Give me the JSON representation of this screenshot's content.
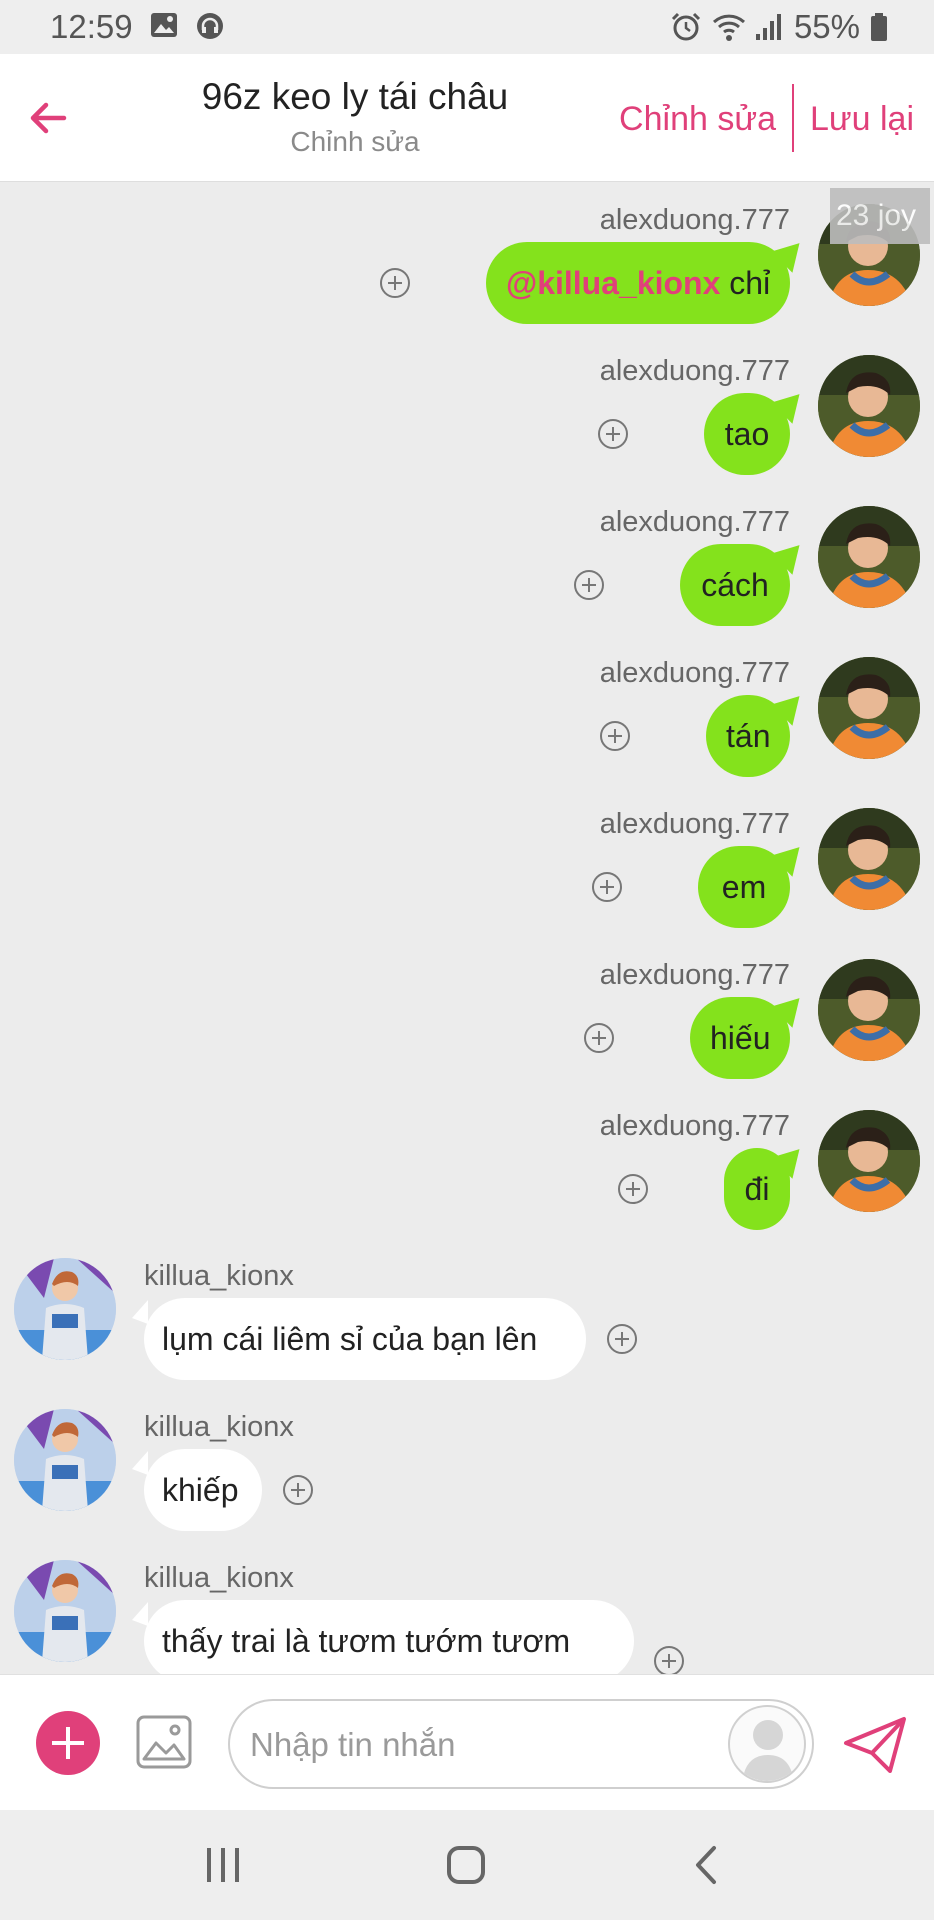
{
  "status_bar": {
    "time": "12:59",
    "battery": "55%",
    "icons": [
      "gallery-icon",
      "headphones-icon",
      "alarm-icon",
      "wifi-icon",
      "signal-icon",
      "battery-icon"
    ]
  },
  "header": {
    "title": "96z keo ly tái châu",
    "subtitle": "Chỉnh sửa",
    "edit_label": "Chỉnh sửa",
    "save_label": "Lưu lại"
  },
  "chat": {
    "timestamp": "23 joy",
    "messages": [
      {
        "direction": "out",
        "username": "alexduong.777",
        "mention": "@killua_kionx",
        "text": " chỉ"
      },
      {
        "direction": "out",
        "username": "alexduong.777",
        "text": "tao"
      },
      {
        "direction": "out",
        "username": "alexduong.777",
        "text": "cách"
      },
      {
        "direction": "out",
        "username": "alexduong.777",
        "text": "tán"
      },
      {
        "direction": "out",
        "username": "alexduong.777",
        "text": "em"
      },
      {
        "direction": "out",
        "username": "alexduong.777",
        "text": "hiếu"
      },
      {
        "direction": "out",
        "username": "alexduong.777",
        "text": "đi"
      },
      {
        "direction": "in",
        "username": "killua_kionx",
        "text": "lụm cái liêm sỉ của bạn lên"
      },
      {
        "direction": "in",
        "username": "killua_kionx",
        "text": "khiếp"
      },
      {
        "direction": "in",
        "username": "killua_kionx",
        "text": "thấy trai là tươm tướm tươm"
      }
    ]
  },
  "composer": {
    "placeholder": "Nhập tin nhắn"
  },
  "colors": {
    "accent": "#e0407a",
    "outgoing_bubble": "#84e21c",
    "incoming_bubble": "#ffffff",
    "chat_background": "#ececec"
  }
}
